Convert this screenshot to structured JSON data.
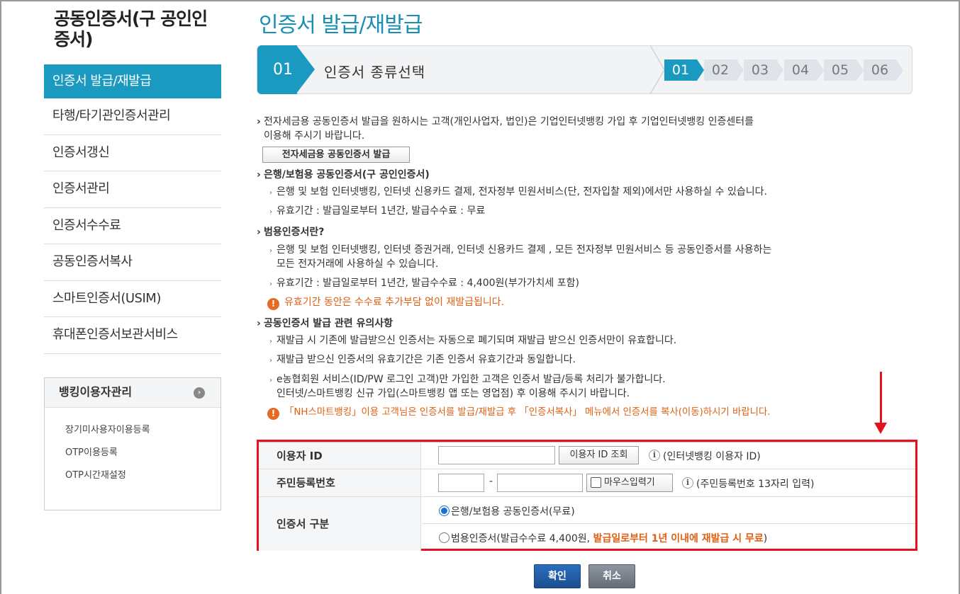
{
  "sidebar": {
    "title": "공동인증서(구 공인인증서)",
    "menu": [
      "인증서 발급/재발급",
      "타행/타기관인증서관리",
      "인증서갱신",
      "인증서관리",
      "인증서수수료",
      "공동인증서복사",
      "스마트인증서(USIM)",
      "휴대폰인증서보관서비스"
    ],
    "banking": {
      "title": "뱅킹이용자관리",
      "links": [
        "장기미사용자이용등록",
        "OTP이용등록",
        "OTP시간재설정"
      ]
    }
  },
  "main": {
    "title": "인증서 발급/재발급",
    "steps": {
      "current_num": "01",
      "current_label": "인증서 종류선택",
      "nums": [
        "01",
        "02",
        "03",
        "04",
        "05",
        "06"
      ]
    },
    "content": {
      "intro_line1": "전자세금용 공동인증서 발급을 원하시는 고객(개인사업자, 법인)은 기업인터넷뱅킹 가입 후 기업인터넷뱅킹 인증센터를",
      "intro_line2": "이용해 주시기 바랍니다.",
      "ebill_button": "전자세금용 공동인증서 발급",
      "bank_heading": "은행/보험용 공동인증서(구 공인인증서)",
      "bank_item1": "은행 및 보험 인터넷뱅킹, 인터넷 신용카드 결제, 전자정부 민원서비스(단, 전자입찰 제외)에서만 사용하실 수 있습니다.",
      "bank_item2": "유효기간 : 발급일로부터 1년간, 발급수수료 : 무료",
      "general_heading": "범용인증서란?",
      "general_item1_line1": "은행 및 보험 인터넷뱅킹, 인터넷 증권거래, 인터넷 신용카드 결제 , 모든 전자정부 민원서비스 등 공동인증서를 사용하는",
      "general_item1_line2": "모든 전자거래에 사용하실 수 있습니다.",
      "general_item2": "유효기간 : 발급일로부터 1년간, 발급수수료 : 4,400원(부가가치세 포함)",
      "general_warning": "유효기간 동안은 수수료 추가부담 없이 재발급됩니다.",
      "notice_heading": "공동인증서 발급 관련 유의사항",
      "notice_item1": "재발급 시 기존에 발급받으신 인증서는 자동으로 폐기되며 재발급 받으신 인증서만이 유효합니다.",
      "notice_item2": "재발급 받으신 인증서의 유효기간은 기존 인증서 유효기간과 동일합니다.",
      "notice_item3_line1": "e농협회원 서비스(ID/PW 로그인 고객)만 가입한 고객은 인증서 발급/등록 처리가 불가합니다.",
      "notice_item3_line2": "인터넷/스마트뱅킹 신규 가입(스마트뱅킹 앱 또는 영업점) 후 이용해 주시기 바랍니다.",
      "notice_warning": "「NH스마트뱅킹」이용 고객님은 인증서를 발급/재발급 후 「인증서복사」 메뉴에서 인증서를 복사(이동)하시기 바랍니다."
    },
    "form": {
      "user_id_label": "이용자 ID",
      "user_id_value": "",
      "user_id_lookup_button": "이용자 ID 조회",
      "user_id_note": "(인터넷뱅킹 이용자 ID)",
      "rrn_label": "주민등록번호",
      "rrn_front_value": "",
      "rrn_separator": "-",
      "rrn_back_value": "",
      "mouse_input_label": "마우스입력기",
      "rrn_note": "(주민등록번호 13자리 입력)",
      "cert_type_label": "인증서 구분",
      "option_bank": "은행/보험용 공동인증서(무료)",
      "option_general_prefix": "범용인증서(발급수수료 4,400원, ",
      "option_general_highlight": "발급일로부터 1년 이내에 재발급 시 무료",
      "option_general_suffix": ")",
      "selected_option": "bank"
    },
    "buttons": {
      "confirm": "확인",
      "cancel": "취소"
    }
  },
  "colors": {
    "accent": "#1a9ac0",
    "warning": "#e15f12",
    "highlight_box": "#e3121e"
  },
  "icons": {
    "info": "info-icon",
    "warning": "warning-icon",
    "arrow": "down-arrow-annotation"
  }
}
